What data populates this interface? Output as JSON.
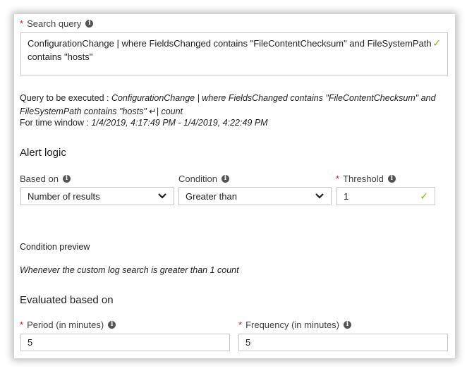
{
  "search_query": {
    "label": "Search query",
    "required_marker": "*",
    "value_line1": "ConfigurationChange | where FieldsChanged contains \"FileContentChecksum\" and FileSystemPath",
    "value_line2": "contains \"hosts\"",
    "valid": true
  },
  "query_info": {
    "query_prefix": "Query to be executed : ",
    "query_line1": "ConfigurationChange | where FieldsChanged contains \"FileContentChecksum\" and",
    "query_line2": "FileSystemPath contains \"hosts\" ↵| count",
    "time_prefix": "For time window : ",
    "time_value": "1/4/2019, 4:17:49 PM - 1/4/2019, 4:22:49 PM"
  },
  "alert_logic": {
    "heading": "Alert logic",
    "based_on": {
      "label": "Based on",
      "value": "Number of results"
    },
    "condition": {
      "label": "Condition",
      "value": "Greater than"
    },
    "threshold": {
      "label": "Threshold",
      "required_marker": "*",
      "value": "1",
      "valid": true
    }
  },
  "condition_preview": {
    "label": "Condition preview",
    "text": "Whenever the custom log search is greater than 1 count"
  },
  "evaluated": {
    "heading": "Evaluated based on",
    "period": {
      "label": "Period (in minutes)",
      "required_marker": "*",
      "value": "5"
    },
    "frequency": {
      "label": "Frequency (in minutes)",
      "required_marker": "*",
      "value": "5"
    }
  },
  "colors": {
    "required": "#e81123",
    "valid_check": "#7fba00"
  },
  "icons": {
    "info": "info-icon",
    "check": "checkmark-icon",
    "chevron": "chevron-down-icon"
  }
}
